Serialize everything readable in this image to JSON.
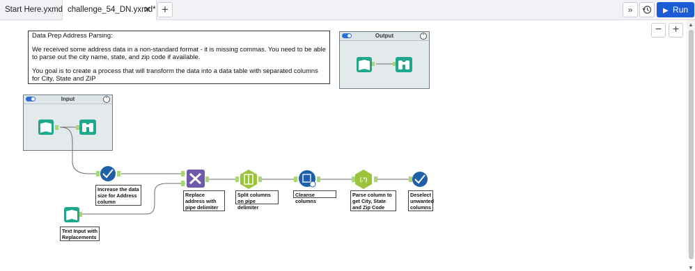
{
  "tabs": [
    {
      "label": "Start Here.yxmd"
    },
    {
      "label": "challenge_54_DN.yxmd*"
    }
  ],
  "toolbar": {
    "new_tab": "+",
    "expand": "»",
    "run_label": "Run"
  },
  "zoom": {
    "minus": "−",
    "plus": "+"
  },
  "comment": {
    "title": "Data Prep Address Parsing:",
    "paragraph1": "We received some address data in a non-standard format - it is missing commas.   You need to be able to parse out the city name, state, and zip code if available.",
    "paragraph2": "You goal is to create a process that will transform the data into a data table with separated columns for City, State and ZIP"
  },
  "containers": {
    "output": {
      "title": "Output"
    },
    "input": {
      "title": "Input"
    }
  },
  "tools": {
    "select1": "Increase the data size for Address column",
    "formula": "Replace address with pipe delimiter",
    "text_to_columns": "Split columns on pipe delimiter",
    "cleanse": "Cleanse columns",
    "regex": "Parse column to get City, State and Zip Code",
    "select2": "Deselect unwanted columns",
    "text_input": "Text Input with Replacements"
  },
  "colors": {
    "input_tool": "#1fa88b",
    "prep_tool": "#1e5fa8",
    "formula_tool": "#6e5aa8",
    "parse_tool": "#9bc43b",
    "connector": "#6b6b6b",
    "run_button": "#1c5bd6"
  }
}
